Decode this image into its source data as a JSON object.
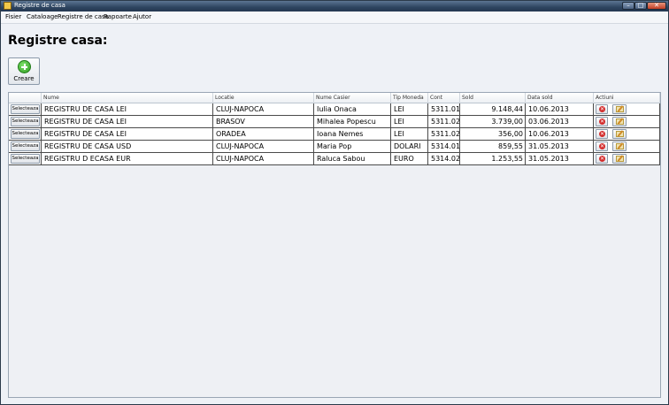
{
  "window": {
    "title": "Registre de casa",
    "controls": [
      "minimize",
      "maximize",
      "close"
    ]
  },
  "menu": [
    {
      "label": "Fisier"
    },
    {
      "label": "Cataloage"
    },
    {
      "label": "Registre de casa"
    },
    {
      "label": "Rapoarte"
    },
    {
      "label": "Ajutor"
    }
  ],
  "page": {
    "title": "Registre casa:",
    "create_label": "Creare",
    "create_icon": "plus-circle-icon"
  },
  "table": {
    "columns": [
      "",
      "Nume",
      "Locatie",
      "Nume Casier",
      "Tip Moneda",
      "Cont",
      "Sold",
      "Data sold",
      "Actiuni"
    ],
    "select_label": "Selecteaza",
    "rows": [
      {
        "nume": "REGISTRU DE CASA LEI",
        "locatie": "CLUJ-NAPOCA",
        "casier": "Iulia Onaca",
        "moneda": "LEI",
        "cont": "5311.01",
        "sold": "9.148,44",
        "data": "10.06.2013"
      },
      {
        "nume": "REGISTRU DE CASA LEI",
        "locatie": "BRASOV",
        "casier": "Mihalea Popescu",
        "moneda": "LEI",
        "cont": "5311.02",
        "sold": "3.739,00",
        "data": "03.06.2013"
      },
      {
        "nume": "REGISTRU DE CASA LEI",
        "locatie": "ORADEA",
        "casier": "Ioana Nemes",
        "moneda": "LEI",
        "cont": "5311.02",
        "sold": "356,00",
        "data": "10.06.2013"
      },
      {
        "nume": "REGISTRU DE CASA USD",
        "locatie": "CLUJ-NAPOCA",
        "casier": "Maria Pop",
        "moneda": "DOLARI",
        "cont": "5314.01",
        "sold": "859,55",
        "data": "31.05.2013"
      },
      {
        "nume": "REGISTRU D ECASA EUR",
        "locatie": "CLUJ-NAPOCA",
        "casier": "Raluca Sabou",
        "moneda": "EURO",
        "cont": "5314.02",
        "sold": "1.253,55",
        "data": "31.05.2013"
      }
    ],
    "action_icons": [
      "delete-icon",
      "edit-icon"
    ]
  },
  "colors": {
    "titlebar": "#2e4560",
    "grid_border": "#4b4b4b",
    "background": "#eef1f6"
  }
}
